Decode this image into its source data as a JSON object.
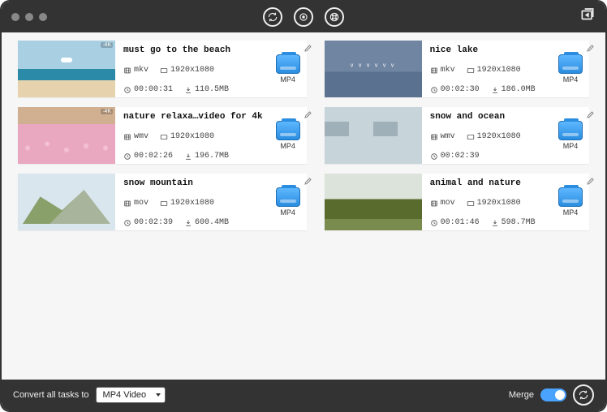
{
  "bottom": {
    "convert_label": "Convert all tasks to",
    "format_selected": "MP4 Video",
    "merge_label": "Merge"
  },
  "items": [
    {
      "title": "must go to the beach",
      "container": "mkv",
      "resolution": "1920x1080",
      "duration": "00:00:31",
      "size": "110.5MB",
      "out": "MP4",
      "badge4k": "·4K",
      "thumb": "t-beach"
    },
    {
      "title": "nice lake",
      "container": "mkv",
      "resolution": "1920x1080",
      "duration": "00:02:30",
      "size": "186.0MB",
      "out": "MP4",
      "badge4k": "",
      "thumb": "t-lake"
    },
    {
      "title": "nature relaxa…video for 4k",
      "container": "wmv",
      "resolution": "1920x1080",
      "duration": "00:02:26",
      "size": "196.7MB",
      "out": "MP4",
      "badge4k": "·4K",
      "thumb": "t-flamingo"
    },
    {
      "title": "snow and  ocean",
      "container": "wmv",
      "resolution": "1920x1080",
      "duration": "00:02:39",
      "size": "",
      "out": "MP4",
      "badge4k": "",
      "thumb": "t-snowocean"
    },
    {
      "title": "snow mountain",
      "container": "mov",
      "resolution": "1920x1080",
      "duration": "00:02:39",
      "size": "600.4MB",
      "out": "MP4",
      "badge4k": "",
      "thumb": "t-snowm"
    },
    {
      "title": "animal and nature",
      "container": "mov",
      "resolution": "1920x1080",
      "duration": "00:01:46",
      "size": "598.7MB",
      "out": "MP4",
      "badge4k": "",
      "thumb": "t-animal"
    }
  ]
}
